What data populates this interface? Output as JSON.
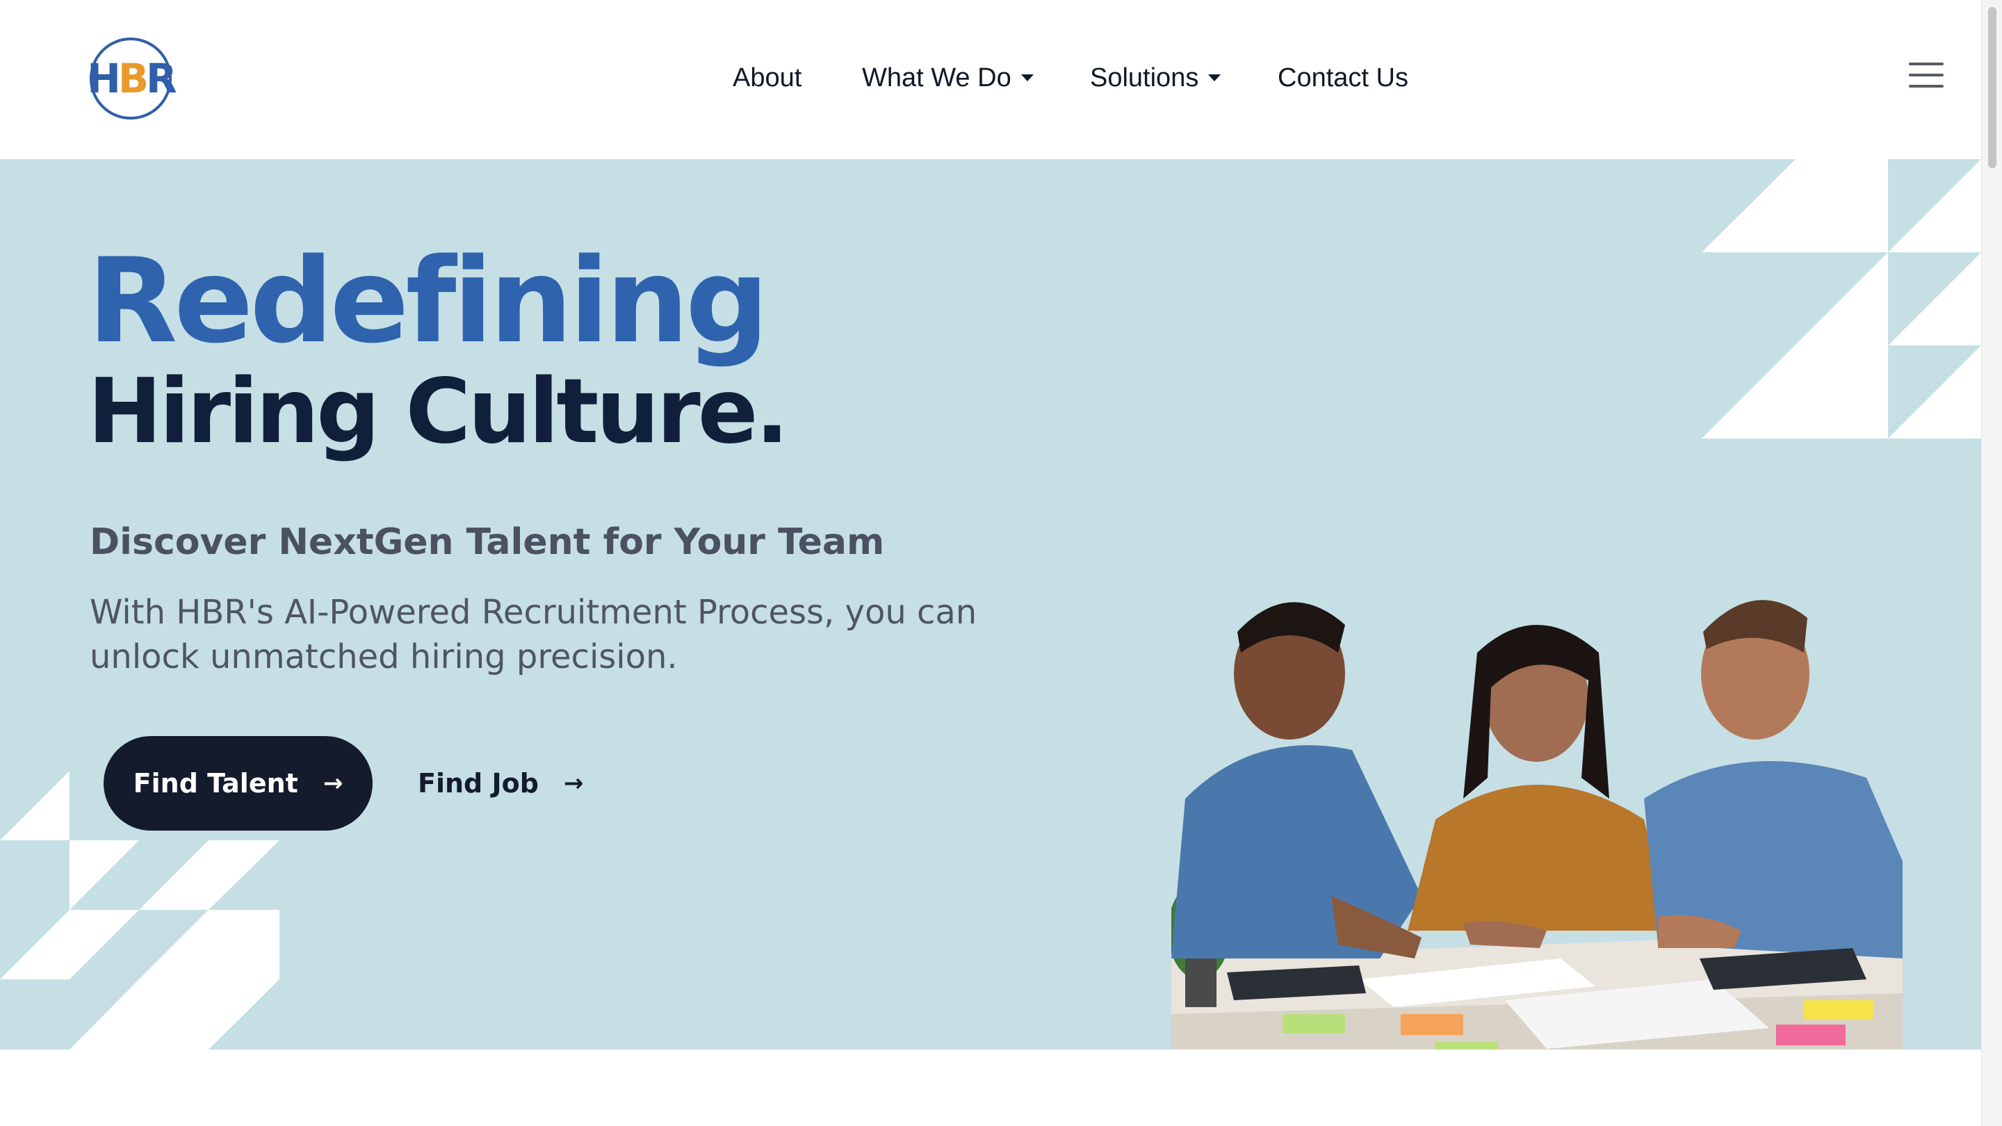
{
  "brand": {
    "logo_text_h": "H",
    "logo_text_b": "B",
    "logo_text_r": "R",
    "colors": {
      "primary": "#2f63ad",
      "accent": "#e89a2c",
      "dark": "#141b2d",
      "hero_bg": "#c5dfe5"
    }
  },
  "nav": {
    "items": [
      {
        "label": "About",
        "has_dropdown": false
      },
      {
        "label": "What We Do",
        "has_dropdown": true
      },
      {
        "label": "Solutions",
        "has_dropdown": true
      },
      {
        "label": "Contact Us",
        "has_dropdown": false
      }
    ],
    "menu_icon": "hamburger-icon"
  },
  "hero": {
    "headline_line1": "Redefining",
    "headline_line2": "Hiring Culture.",
    "subheading": "Discover NextGen Talent for Your Team",
    "description": "With HBR's AI-Powered Recruitment Process, you can unlock unmatched hiring precision.",
    "primary_cta": "Find Talent",
    "secondary_cta": "Find Job",
    "arrow": "→",
    "image_subject": "team-collaboration-photo"
  }
}
